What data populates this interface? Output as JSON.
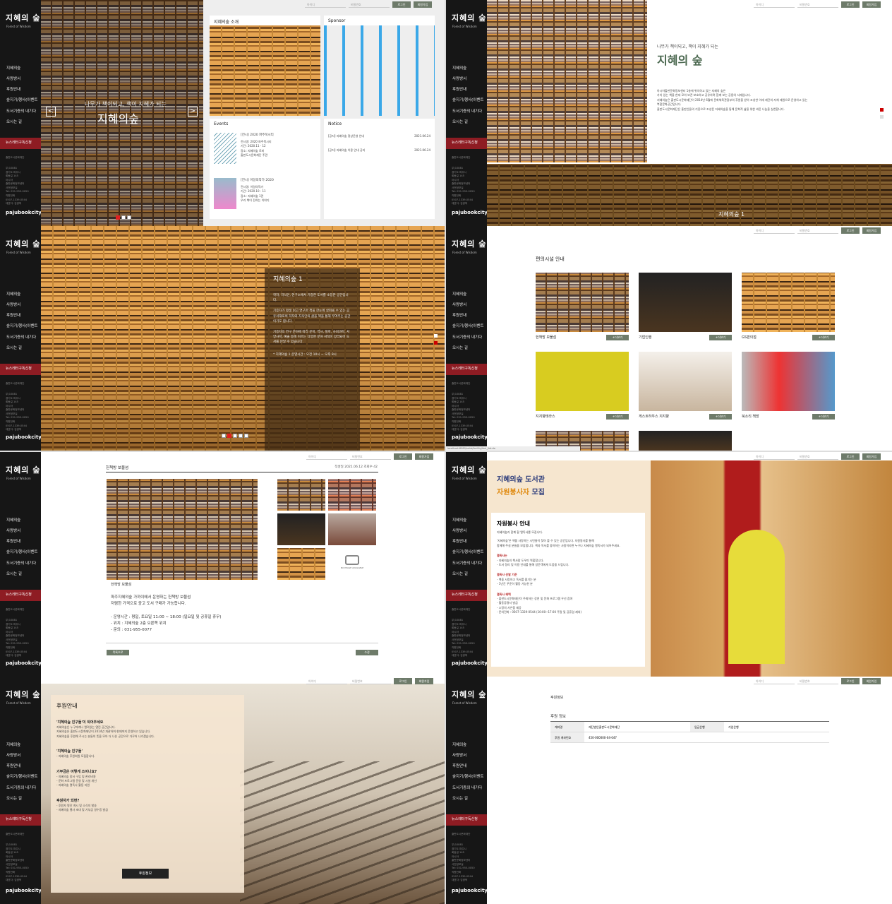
{
  "sidebar": {
    "logo": "지혜의 숲",
    "logo_sub": "Forest of Wisdom",
    "menu": [
      "지혜의숲",
      "사랑방서",
      "후원안내",
      "숲지기/행사(이벤트",
      "도서기증의 내기다",
      "오시는 길"
    ],
    "newsletter": "뉴스레터구독신청",
    "org": "출판도시문화재단",
    "address_lines": [
      "우)10881",
      "경기도 파주시",
      "회동길 145",
      "아시아",
      "출판문화정보센터",
      "사전정보실",
      "Tel: 031-955-0050",
      "직원전화",
      "0507-1339-0544",
      "대표자: 김광욱"
    ],
    "footer": "pajubookcity"
  },
  "topbar": {
    "id_placeholder": "아이디",
    "pw_placeholder": "비밀번호",
    "login": "로그인",
    "join": "회원가입"
  },
  "p1": {
    "hero_sub": "나무가 책이되고, 책이 지혜가 되는",
    "hero_title": "지혜의숲",
    "prev": "<",
    "next": ">",
    "card1_title": "지혜의숲 소개",
    "card2_title": "Sponsor",
    "events_title": "Events",
    "notice_title": "Notice",
    "events": [
      {
        "title": "[전시] 2020 파주북시티",
        "desc": [
          "전시명: 2020 파주북시티",
          "기간: 2020.11 - 12",
          "장소: 지혜의숲 로비",
          "출판도시문화재단 주관"
        ]
      },
      {
        "title": "[전시] 이달의작가 2020",
        "desc": [
          "전시명: 이달의작가",
          "기간: 2020.10 - 11",
          "장소: 지혜의숲 1관",
          "우리 책이 전하는 이야기"
        ]
      }
    ],
    "notices": [
      {
        "title": "[공지] 지혜의숲 정상운영 안내",
        "date": "2021.06.24"
      },
      {
        "title": "[공지] 지혜의숲 이용 안내 공지",
        "date": "2021.06.24"
      }
    ]
  },
  "p2": {
    "sub": "나무가 책이되고, 책이 지혜가 되는",
    "title": "지혜의 숲",
    "paragraph": [
      "아시아출판문화정보센터 1층에 위치하고 있는 지혜의 숲은",
      "가치 있는 책을 한데 모아 보존·보호하고 공유하며 함께 보는 공용의 서재입니다.",
      "지혜의숲은 출판도시문화재단이 2014년 6월에 문화체육관광부의 후원을 받아 조성한 이래 재단의 자체 재원으로 운영하고 있는",
      "복합문화공간입니다.",
      "출판도시문화재단은 출판인들의 기증으로 조성된 지혜의숲을 통해 문화적 삶을 위한 바른 나눔을 실천합니다."
    ],
    "caption": "지혜의숲 1"
  },
  "p3": {
    "title": "지혜의숲 1",
    "paragraphs": [
      "학자, 지식인, 연구소에서 기증한 도서를 소장한 공간입니다.",
      "기증자가 평생 읽고 연구한 책을 한눈에 살펴볼 수 있는 공유서재로써 학자와 지식인의 삶을 책을 통해 부여주는 공간이기도 합니다.",
      "기증자의 연구 분야에 따라 문학, 역사, 철학, 사회과학, 서양사학, 예술 등에 이르는 다양한 분야 서적이 망라되어 도서를 만날 수 있습니다."
    ],
    "hours": "* 지혜의숲 1 운영시간 : 오전 10시 ~ 오후 8시"
  },
  "p4": {
    "title": "편의시설 안내",
    "items": [
      {
        "name": "헌책방 보물섬",
        "btn": "+더보기"
      },
      {
        "name": "기업인행",
        "btn": "+더보기"
      },
      {
        "name": "GS편의점",
        "btn": "+더보기"
      },
      {
        "name": "지지향테라스",
        "btn": "+더보기"
      },
      {
        "name": "게스트하우스 지지향",
        "btn": "+더보기"
      },
      {
        "name": "북소리 책방",
        "btn": "+더보기"
      }
    ],
    "url": "localhost:8080/sshb/facility/faci_list.do"
  },
  "p5": {
    "title": "헌책방 보물섬",
    "meta": "작성일 2021.06.12   조회수 42",
    "no_image": "NO IMAGE AVAILABLE",
    "caption": "헌책방 보물섬",
    "lines": [
      "파주지혜의숲 가까이에서 운영하는 헌책방 보물섬",
      "저렴한 가격으로 중고 도서 구매가 가능합니다.",
      "",
      "- 운영시간 : 평일, 토요일 11:00 ~ 18:00 (일요일 및 공휴일 휴무)",
      "- 위치 : 지혜의숲 2층 오른쪽 위치",
      "- 문의 : 031-955-0077"
    ],
    "back": "목록으로",
    "btn": "수정"
  },
  "p6": {
    "banner_line1": "지혜의숲 도서관",
    "banner_line2a": "자원봉사자",
    "banner_line2b": "모집",
    "title": "자원봉사 안내",
    "intro": "지혜의숲과 함께 할 열독서를 모집니다.",
    "body": [
      "'지혜의숲'은 책을 사랑하는 시민들이 찾아 볼 수 있는 공간입니다. 자원봉사를 통해",
      "함께해 주실 분들을 모집합니다. 책과 독서를 좋아하는 사람이라면 누구나 지혜의숲 열독서가 되어주세요."
    ],
    "s1_title": "열독사는",
    "s1": [
      "- 지혜의숲의 책사람 도우미 역할합니다.",
      "- 도서 정리 및 이용 안내를 통해 방문객에게 도움을 드립니다."
    ],
    "s2_title": "열독사 선발 기준",
    "s2": [
      "- 책을 사랑하고 독서를 즐기는 분",
      "- 1년간 꾸준히 활동 가능한 분"
    ],
    "s3_title": "열독사 혜택",
    "s3": [
      "- 출판도시문화재단이 주최하는 강연 및 문화 프로그램 우선 참여",
      "- 활동증명서 발급",
      "- 소정의 사은품 제공",
      "- 문의전화 : 0507-1339-0544 (10:00~17:00 주말 및 공휴일 제외)"
    ]
  },
  "p7": {
    "title": "후원안내",
    "s1_title": "'지혜의숲 친구들'이 되어주세요",
    "s1": [
      "지혜의숲은 누구에게나 열려있는 열린 공간입니다.",
      "지혜의숲은 출판도시문화재단이 2014년 개관하여 현재까지 운영하고 있습니다.",
      "지혜의숲을 후원해 주시는 분들의 뜻을 모아 더 나은 공간으로 가꾸어 나가겠습니다."
    ],
    "s2_title": "'지혜의숲 친구들'",
    "s2": [
      "- 지혜의숲 후원회원 모집합니다."
    ],
    "s3_title": "기부금은 어떻게 쓰이나요?",
    "s3": [
      "- 지혜의숲 장서 구입 및 관리비용",
      "- 문화 프로그램 운영 및 시설 개선",
      "- 지혜의숲 열독사 활동 지원"
    ],
    "s4_title": "후원자가 되면?",
    "s4": [
      "- 후원자 명단 게시 및 소식지 발송",
      "- 지혜의숲 행사 초대 및 기부금 영수증 발급"
    ],
    "button": "후원정보"
  },
  "p8": {
    "header": "후원정보",
    "sub": "후원 정보",
    "rows": [
      {
        "k1": "계좌명",
        "v1": "재단법인출판도시문화재단",
        "k2": "입금은행",
        "v2": "기업은행"
      },
      {
        "k1": "후원 계좌번호",
        "v1": "450-000000-04-047",
        "k2": "",
        "v2": ""
      }
    ]
  }
}
